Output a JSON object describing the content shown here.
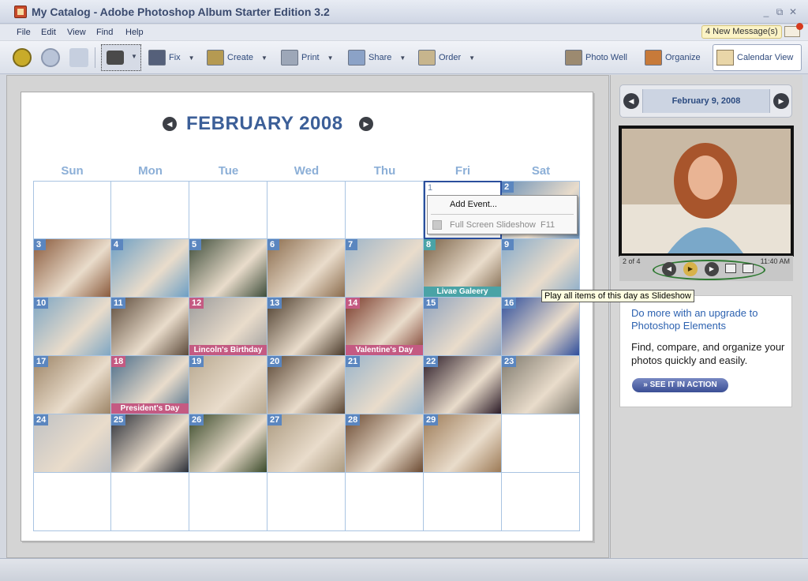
{
  "window": {
    "title": "My Catalog - Adobe Photoshop Album Starter Edition 3.2",
    "controls": [
      "_",
      "⧉",
      "✕"
    ]
  },
  "menu": {
    "items": [
      "File",
      "Edit",
      "View",
      "Find",
      "Help"
    ]
  },
  "messages": {
    "label": "4 New Message(s)"
  },
  "toolbar": {
    "back_icon": "back-arrow-icon",
    "forward_icon": "forward-arrow-icon",
    "home_icon": "home-icon",
    "camera_icon": "camera-icon",
    "fix": "Fix",
    "create": "Create",
    "print": "Print",
    "share": "Share",
    "order": "Order",
    "photo_well": "Photo Well",
    "organize": "Organize",
    "calendar_view": "Calendar View"
  },
  "calendar": {
    "month_title": "FEBRUARY  2008",
    "weekdays": [
      "Sun",
      "Mon",
      "Tue",
      "Wed",
      "Thu",
      "Fri",
      "Sat"
    ],
    "days": [
      {
        "day": "",
        "photo": false
      },
      {
        "day": "",
        "photo": false
      },
      {
        "day": "",
        "photo": false
      },
      {
        "day": "",
        "photo": false
      },
      {
        "day": "",
        "photo": false
      },
      {
        "day": "1",
        "photo": false,
        "selected": true
      },
      {
        "day": "2",
        "photo": true,
        "color": "#6f93b8"
      },
      {
        "day": "3",
        "photo": true,
        "color": "#8a5a3c"
      },
      {
        "day": "4",
        "photo": true,
        "color": "#6d9fc4"
      },
      {
        "day": "5",
        "photo": true,
        "color": "#3e4d3a"
      },
      {
        "day": "6",
        "photo": true,
        "color": "#8a6b4c"
      },
      {
        "day": "7",
        "photo": true,
        "color": "#9fb5c8"
      },
      {
        "day": "8",
        "photo": true,
        "color": "#7a6247",
        "event": "Livae Galeery",
        "event_color": "#4aa3a6",
        "num_style": "teal"
      },
      {
        "day": "9",
        "photo": true,
        "color": "#86aac9"
      },
      {
        "day": "10",
        "photo": true,
        "color": "#7ea6c3"
      },
      {
        "day": "11",
        "photo": true,
        "color": "#5c4a3a"
      },
      {
        "day": "12",
        "photo": true,
        "color": "#9c9c9c",
        "event": "Lincoln's Birthday",
        "event_color": "#c45a82",
        "holiday": true
      },
      {
        "day": "13",
        "photo": true,
        "color": "#4a3a2a"
      },
      {
        "day": "14",
        "photo": true,
        "color": "#7a3a2a",
        "event": "Valentine's Day",
        "event_color": "#c45a82",
        "holiday": true
      },
      {
        "day": "15",
        "photo": true,
        "color": "#8fa2bd"
      },
      {
        "day": "16",
        "photo": true,
        "color": "#2f4e9c"
      },
      {
        "day": "17",
        "photo": true,
        "color": "#9c8466"
      },
      {
        "day": "18",
        "photo": true,
        "color": "#4b6d8a",
        "event": "President's Day",
        "event_color": "#c45a82",
        "holiday": true
      },
      {
        "day": "19",
        "photo": true,
        "color": "#b7a890"
      },
      {
        "day": "20",
        "photo": true,
        "color": "#5a4634"
      },
      {
        "day": "21",
        "photo": true,
        "color": "#9ab4c9"
      },
      {
        "day": "22",
        "photo": true,
        "color": "#2a1a26"
      },
      {
        "day": "23",
        "photo": true,
        "color": "#7f7a6e"
      },
      {
        "day": "24",
        "photo": true,
        "color": "#bfc1c4"
      },
      {
        "day": "25",
        "photo": true,
        "color": "#2b2f38"
      },
      {
        "day": "26",
        "photo": true,
        "color": "#3a4a2a"
      },
      {
        "day": "27",
        "photo": true,
        "color": "#ab9a80"
      },
      {
        "day": "28",
        "photo": true,
        "color": "#6b4a32"
      },
      {
        "day": "29",
        "photo": true,
        "color": "#9c7a56"
      },
      {
        "day": "",
        "photo": false
      },
      {
        "day": "",
        "photo": false
      },
      {
        "day": "",
        "photo": false
      },
      {
        "day": "",
        "photo": false
      },
      {
        "day": "",
        "photo": false
      },
      {
        "day": "",
        "photo": false
      },
      {
        "day": "",
        "photo": false
      },
      {
        "day": "",
        "photo": false
      }
    ]
  },
  "context_menu": {
    "add_event": "Add Event...",
    "full_screen": "Full Screen Slideshow",
    "full_screen_shortcut": "F11"
  },
  "tooltip": "Play all items of this day as Slideshow",
  "side": {
    "date_label": "February 9, 2008",
    "count": "2 of 4",
    "time": "11:40 AM",
    "promo_title": "Do more with an upgrade to Photoshop Elements",
    "promo_body": "Find, compare, and organize your photos quickly and easily.",
    "promo_button": "»  SEE IT IN ACTION"
  }
}
